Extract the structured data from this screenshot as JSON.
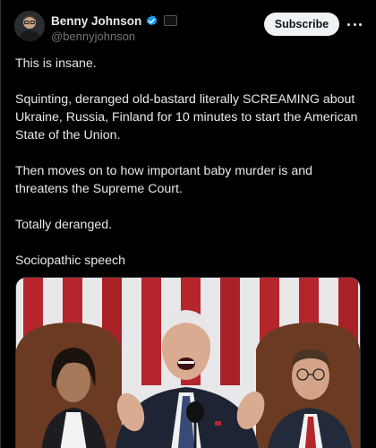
{
  "author": {
    "display_name": "Benny Johnson",
    "handle": "@bennyjohnson",
    "avatar_icon": "avatar-photo"
  },
  "actions": {
    "subscribe_label": "Subscribe",
    "more_icon": "more-options-icon"
  },
  "tweet": {
    "paragraphs": [
      "This is insane.",
      "Squinting, deranged old-bastard literally SCREAMING about Ukraine, Russia, Finland for 10 minutes to start the American State of the Union.",
      "Then moves on to how important baby murder is and threatens the Supreme Court.",
      "Totally deranged.",
      "Sociopathic speech"
    ]
  },
  "media": {
    "type": "photo",
    "description_icon": "state-of-union-photo"
  },
  "colors": {
    "background": "#000000",
    "text": "#e7e9ea",
    "secondary_text": "#71767b",
    "verified_blue": "#1d9bf0",
    "subscribe_bg": "#eff3f4"
  }
}
